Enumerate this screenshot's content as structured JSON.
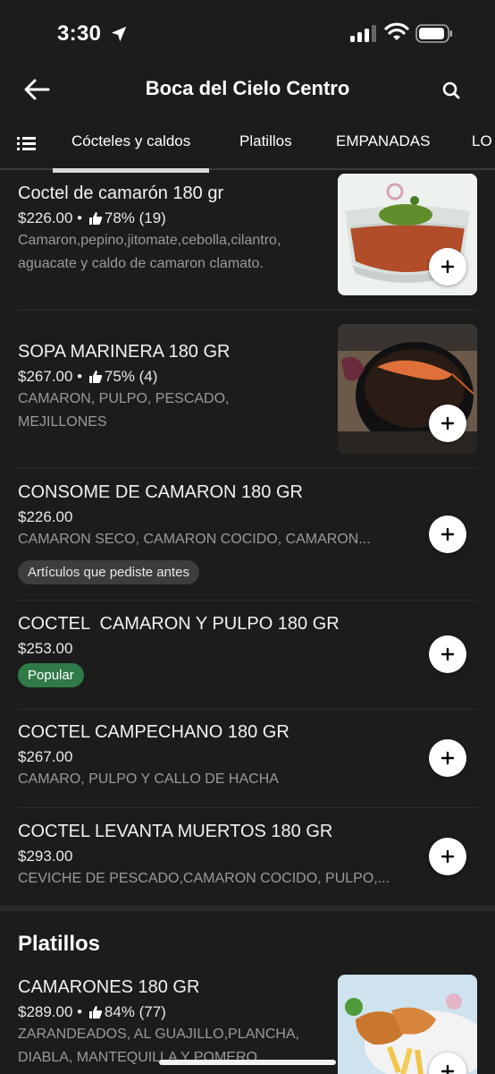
{
  "status": {
    "time": "3:30"
  },
  "header": {
    "title": "Boca del Cielo Centro"
  },
  "tabs": [
    {
      "label": "Cócteles y caldos"
    },
    {
      "label": "Platillos"
    },
    {
      "label": "EMPANADAS"
    },
    {
      "label": "LO"
    }
  ],
  "items": [
    {
      "name": "Coctel de camarón 180 gr",
      "price": "$226.00",
      "rating": "78% (19)",
      "description": "Camaron,pepino,jitomate,cebolla,cilantro, aguacate y caldo de camaron clamato."
    },
    {
      "name": "SOPA MARINERA 180 GR",
      "price": "$267.00",
      "rating": "75% (4)",
      "description": "CAMARON, PULPO, PESCADO, MEJILLONES"
    },
    {
      "name": "CONSOME DE CAMARON 180 GR",
      "price": "$226.00",
      "description": "CAMARON SECO, CAMARON COCIDO, CAMARON...",
      "badge": "Artículos que pediste antes"
    },
    {
      "name": "COCTEL  CAMARON Y PULPO 180 GR",
      "price": "$253.00",
      "badge": "Popular"
    },
    {
      "name": "COCTEL CAMPECHANO 180 GR",
      "price": "$267.00",
      "description": "CAMARO, PULPO Y CALLO DE HACHA"
    },
    {
      "name": "COCTEL LEVANTA MUERTOS 180 GR",
      "price": "$293.00",
      "description": "CEVICHE DE PESCADO,CAMARON COCIDO, PULPO,..."
    }
  ],
  "section": {
    "title": "Platillos"
  },
  "section_items": [
    {
      "name": "CAMARONES 180 GR",
      "price": "$289.00",
      "rating": "84% (77)",
      "description": "ZARANDEADOS, AL GUAJILLO,PLANCHA, DIABLA, MANTEQUILLA Y POMERO..."
    }
  ],
  "colors": {
    "background": "#1c1c1c",
    "popular_badge": "#2f7a47",
    "previous_badge": "#3d3d3d"
  }
}
